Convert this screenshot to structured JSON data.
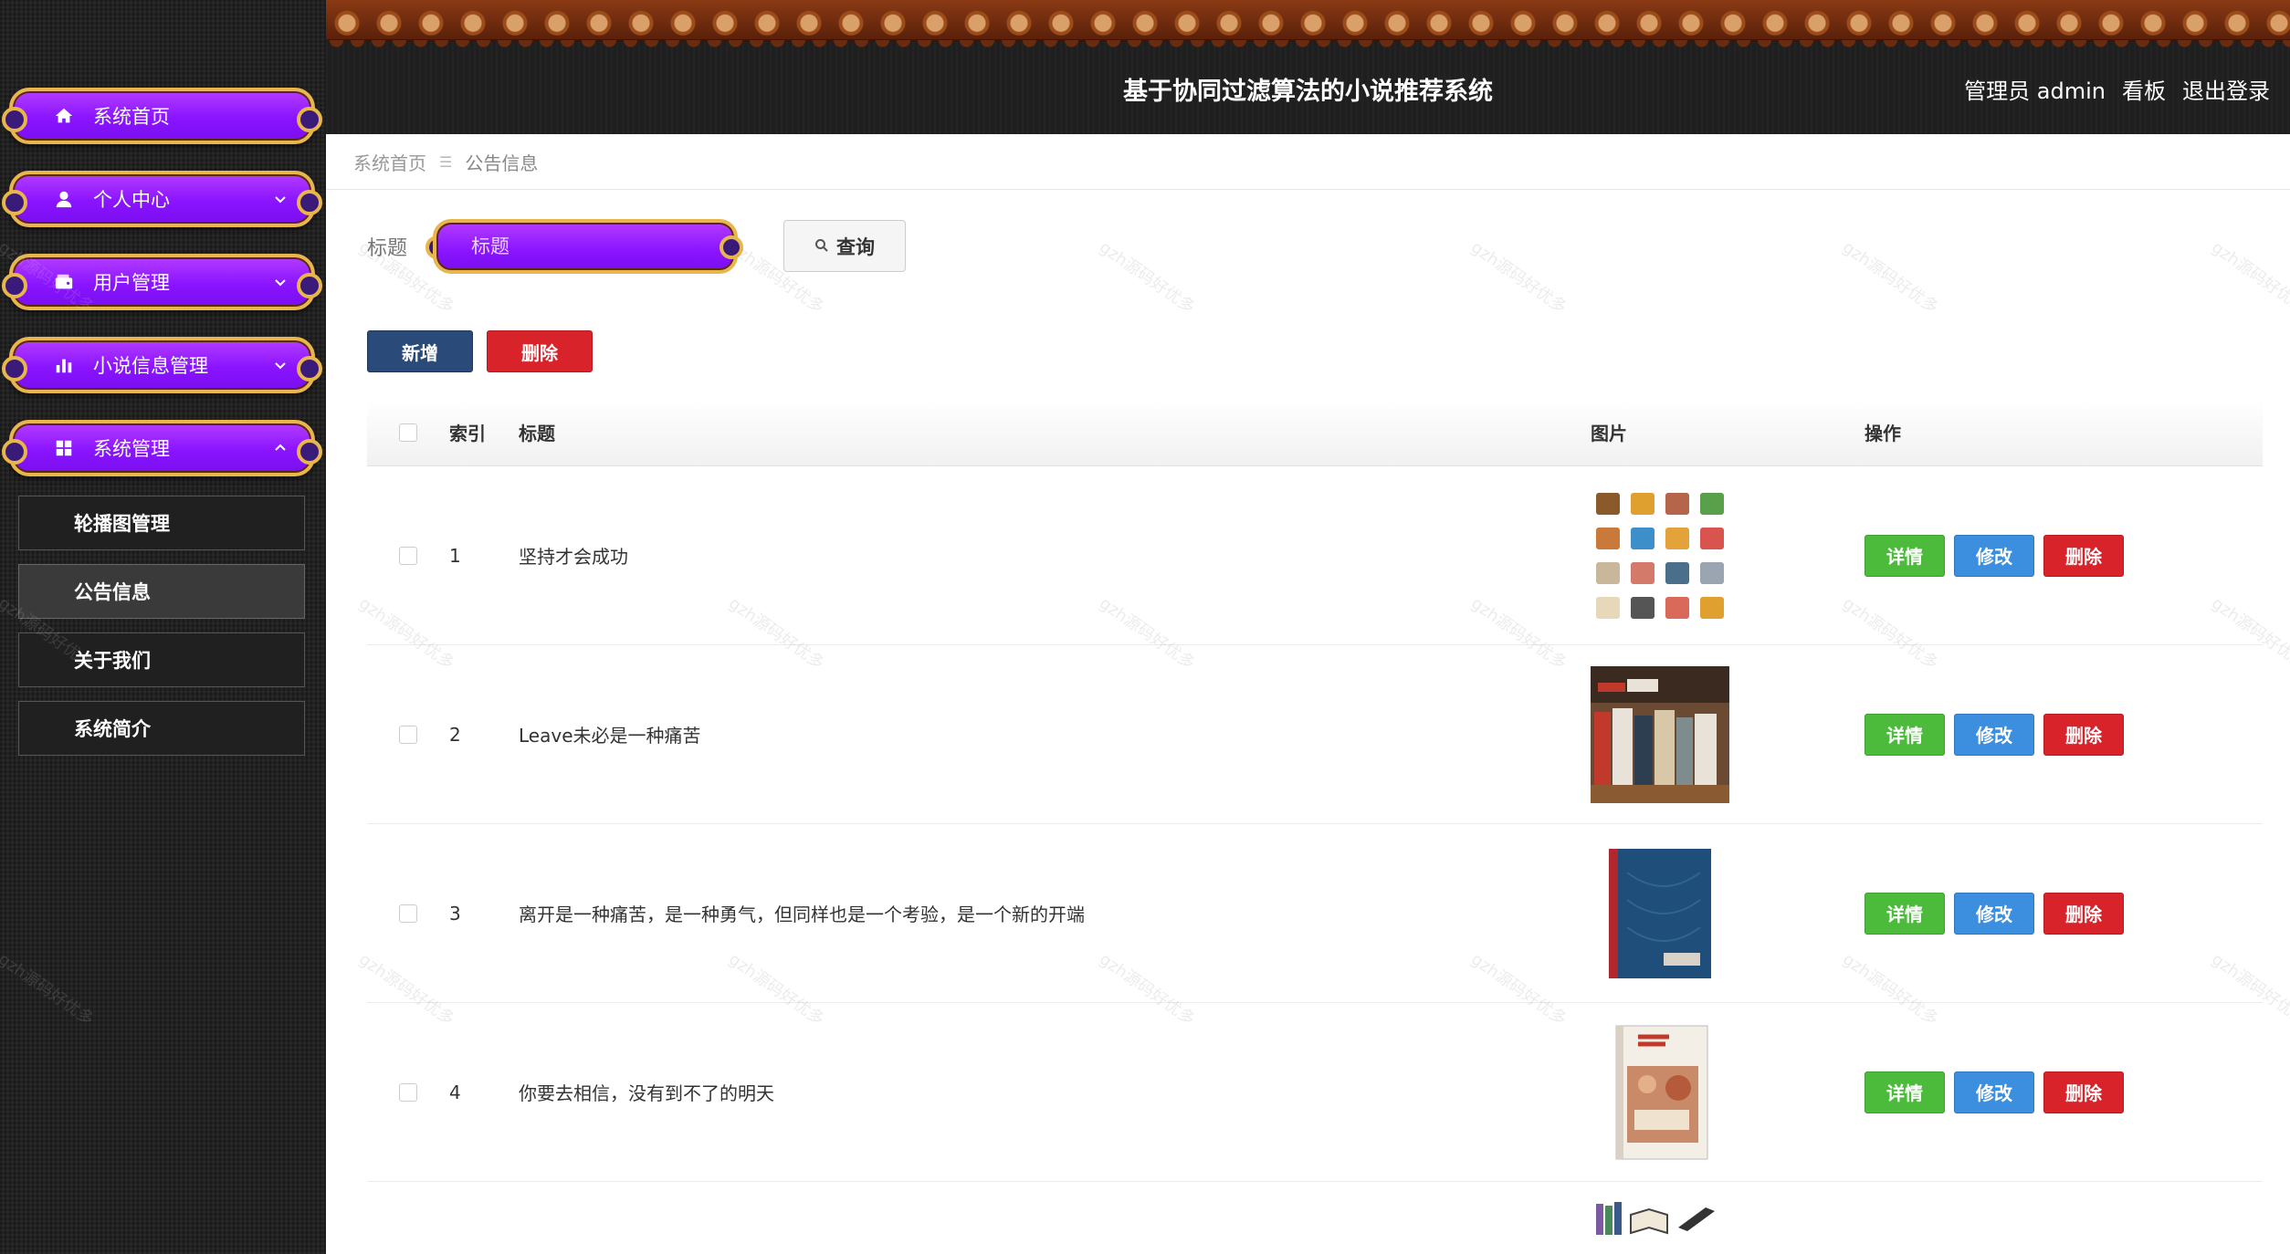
{
  "header": {
    "title": "基于协同过滤算法的小说推荐系统",
    "user_label": "管理员 admin",
    "board_link": "看板",
    "logout_link": "退出登录"
  },
  "sidebar": {
    "menus": [
      {
        "label": "系统首页",
        "icon": "home-icon"
      },
      {
        "label": "个人中心",
        "icon": "user-icon"
      },
      {
        "label": "用户管理",
        "icon": "wallet-icon"
      },
      {
        "label": "小说信息管理",
        "icon": "bar-chart-icon"
      },
      {
        "label": "系统管理",
        "icon": "grid-icon"
      }
    ],
    "submenu": [
      {
        "label": "轮播图管理"
      },
      {
        "label": "公告信息"
      },
      {
        "label": "关于我们"
      },
      {
        "label": "系统简介"
      }
    ]
  },
  "breadcrumb": {
    "home": "系统首页",
    "separator": "☰",
    "current": "公告信息"
  },
  "search": {
    "label": "标题",
    "placeholder": "标题",
    "button_label": "查询"
  },
  "actions": {
    "add_label": "新增",
    "delete_label": "删除"
  },
  "table": {
    "columns": [
      "索引",
      "标题",
      "图片",
      "操作"
    ],
    "rows": [
      {
        "index": "1",
        "title": "坚持才会成功"
      },
      {
        "index": "2",
        "title": "Leave未必是一种痛苦"
      },
      {
        "index": "3",
        "title": "离开是一种痛苦，是一种勇气，但同样也是一个考验，是一个新的开端"
      },
      {
        "index": "4",
        "title": "你要去相信，没有到不了的明天"
      }
    ],
    "ops": {
      "detail": "详情",
      "edit": "修改",
      "delete": "删除"
    }
  },
  "watermark": "gzh源码好优多",
  "colors": {
    "menu_purple": "#8a14ff",
    "menu_gold_border": "#e8b64a",
    "detail_green": "#4cbb3c",
    "edit_blue": "#3b8fde",
    "delete_red": "#d9232a",
    "add_navy": "#2a4a7a"
  }
}
